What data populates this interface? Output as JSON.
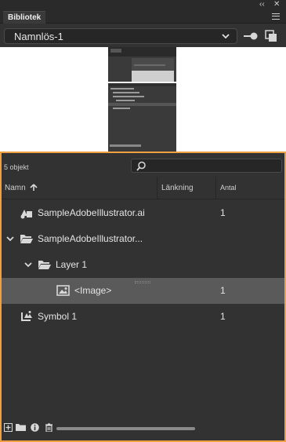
{
  "window": {
    "collapse_label": "‹‹",
    "close_label": "✕"
  },
  "tabs": [
    {
      "label": "Bibliotek"
    }
  ],
  "document": {
    "selected": "Namnlös-1"
  },
  "library": {
    "item_count": "5 objekt",
    "search": {
      "placeholder": "",
      "value": ""
    },
    "columns": {
      "name": "Namn",
      "linkage": "Länkning",
      "count": "Antal"
    },
    "items": [
      {
        "name": "SampleAdobeIllustrator.ai",
        "count": "1",
        "icon": "illustrator-symbol-icon"
      },
      {
        "name": "SampleAdobeIllustrator...",
        "count": "",
        "icon": "folder-open-icon"
      },
      {
        "name": "Layer 1",
        "count": "",
        "icon": "folder-open-icon"
      },
      {
        "name": "<Image>",
        "count": "1",
        "icon": "bitmap-image-icon"
      },
      {
        "name": "Symbol 1",
        "count": "1",
        "icon": "symbol-icon"
      }
    ]
  },
  "colors": {
    "accent": "#f0a040",
    "selected_row": "#5a5a5a",
    "panel_bg": "#323232"
  }
}
